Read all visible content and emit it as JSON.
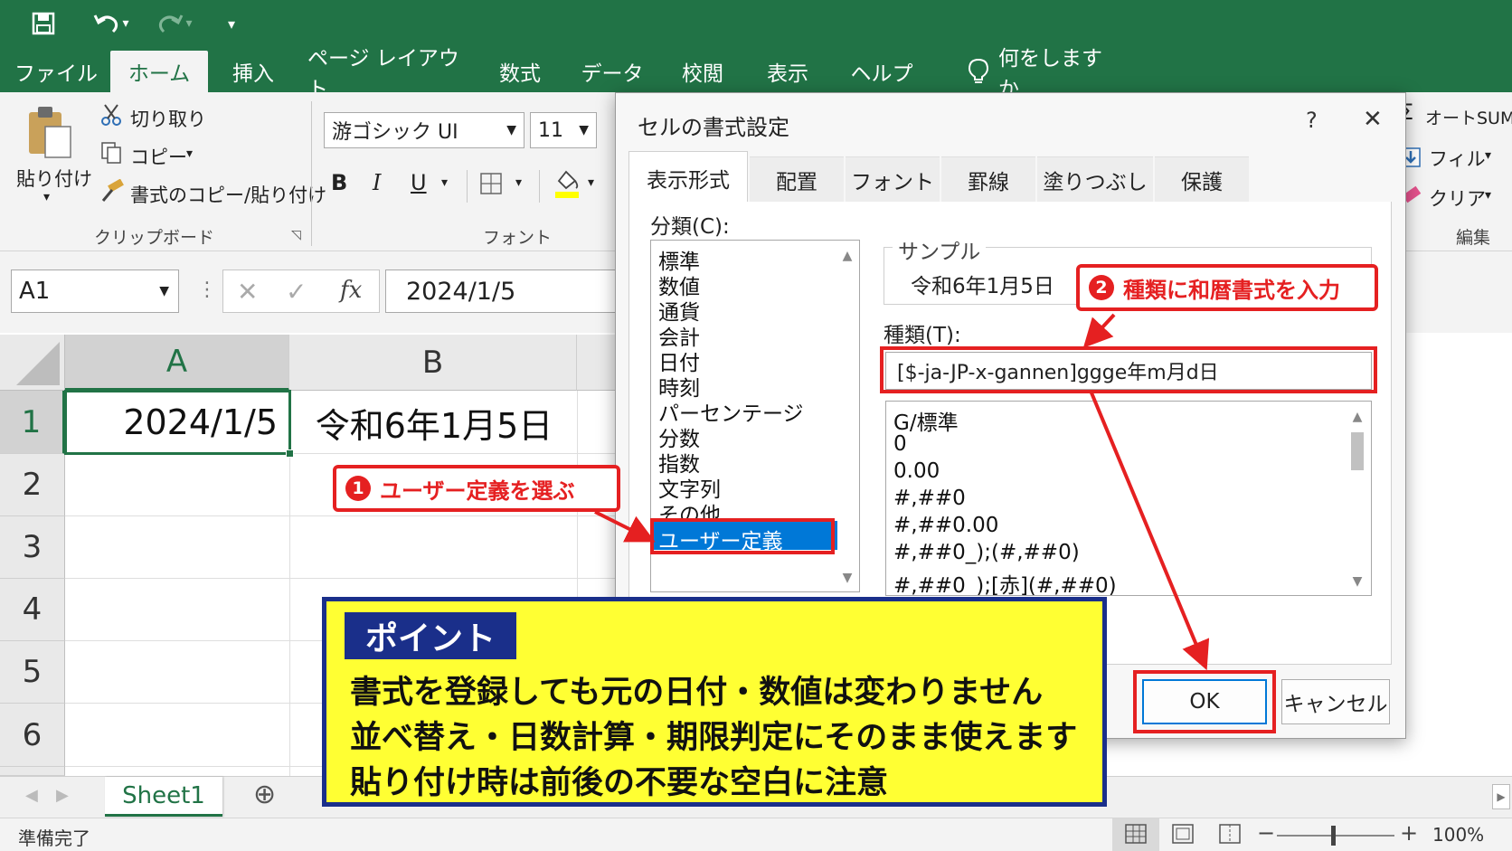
{
  "qat": {
    "save_icon": "save-icon",
    "undo_icon": "undo-icon",
    "redo_icon": "redo-icon",
    "customize_icon": "customize-icon"
  },
  "ribbon_tabs": [
    "ファイル",
    "ホーム",
    "挿入",
    "ページ レイアウト",
    "数式",
    "データ",
    "校閲",
    "表示",
    "ヘルプ"
  ],
  "tell_me": "何をしますか",
  "clipboard": {
    "paste": "貼り付け",
    "cut": "切り取り",
    "copy": "コピー",
    "format_painter": "書式のコピー/貼り付け",
    "group": "クリップボード"
  },
  "font": {
    "name": "游ゴシック UI",
    "size": "11",
    "bold": "B",
    "italic": "I",
    "underline": "U",
    "group": "フォント"
  },
  "editing": {
    "autosum": "オートSUM",
    "fill": "フィル",
    "clear": "クリア",
    "group": "編集"
  },
  "namebox": "A1",
  "formula": {
    "fx": "fx",
    "value": "2024/1/5"
  },
  "grid": {
    "columns": [
      "A",
      "B"
    ],
    "rows": [
      "1",
      "2",
      "3",
      "4",
      "5",
      "6"
    ],
    "a1": "2024/1/5",
    "b1": "令和6年1月5日"
  },
  "sheet": {
    "name": "Sheet1",
    "add": "⊕"
  },
  "status": {
    "ready": "準備完了",
    "zoom": "100%"
  },
  "dialog": {
    "title": "セルの書式設定",
    "help": "?",
    "close": "✕",
    "tabs": [
      "表示形式",
      "配置",
      "フォント",
      "罫線",
      "塗りつぶし",
      "保護"
    ],
    "category_label": "分類(C):",
    "categories": [
      "標準",
      "数値",
      "通貨",
      "会計",
      "日付",
      "時刻",
      "パーセンテージ",
      "分数",
      "指数",
      "文字列",
      "その他",
      "ユーザー定義"
    ],
    "sample_label": "サンプル",
    "sample_value": "令和6年1月5日",
    "type_label": "種類(T):",
    "type_value": "[$-ja-JP-x-gannen]ggge年m月d日",
    "type_list": [
      "G/標準",
      "0",
      "0.00",
      "#,##0",
      "#,##0.00",
      "#,##0_);(#,##0)",
      "#,##0_);[赤](#,##0)"
    ],
    "ok": "OK",
    "cancel": "キャンセル"
  },
  "callouts": {
    "step1_num": "1",
    "step1": "ユーザー定義を選ぶ",
    "step2_num": "2",
    "step2": "種類に和暦書式を入力"
  },
  "point": {
    "title": "ポイント",
    "lines": [
      "書式を登録しても元の日付・数値は変わりません",
      "並べ替え・日数計算・期限判定にそのまま使えます",
      "貼り付け時は前後の不要な空白に注意"
    ]
  },
  "colors": {
    "excel_green": "#217346",
    "callout_red": "#e52021",
    "point_yellow": "#ffff33",
    "point_navy": "#1a2f8a",
    "selection_blue": "#0078d7"
  }
}
